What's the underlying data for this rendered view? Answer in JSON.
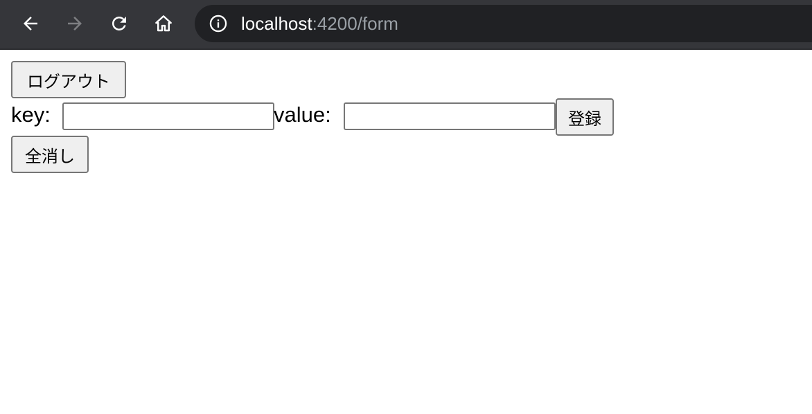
{
  "browser": {
    "url_host": "localhost",
    "url_rest": ":4200/form"
  },
  "page": {
    "logout_label": "ログアウト",
    "key_label": "key:",
    "key_value": "",
    "value_label": "value:",
    "value_value": "",
    "register_label": "登録",
    "clear_all_label": "全消し"
  }
}
